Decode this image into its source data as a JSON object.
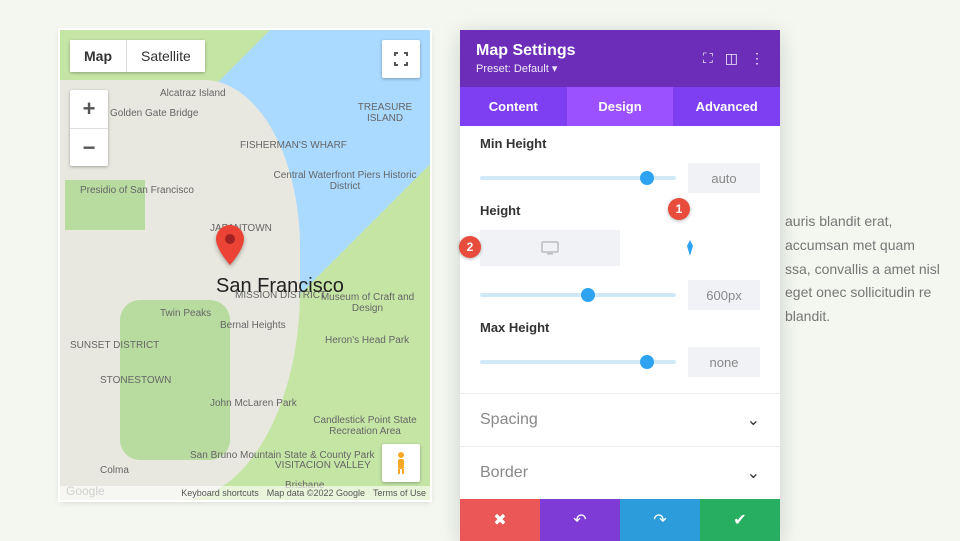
{
  "bg_text": "auris blandit erat, accumsan met quam ssa, convallis a amet nisl eget onec sollicitudin re blandit.",
  "map": {
    "tab_map": "Map",
    "tab_satellite": "Satellite",
    "zoom_in": "+",
    "zoom_out": "−",
    "city": "San Francisco",
    "places": {
      "alcatraz": "Alcatraz Island",
      "treasure": "TREASURE\nISLAND",
      "ggb": "Golden Gate Bridge",
      "fisherman": "FISHERMAN'S\nWHARF",
      "central": "Central\nWaterfront\nPiers Historic\nDistrict",
      "presidio": "Presidio of\nSan Francisco",
      "jt": "JAPANTOWN",
      "mission": "MISSION\nDISTRICT",
      "craft": "Museum of\nCraft and Design",
      "twin": "Twin Peaks",
      "bernal": "Bernal Heights",
      "herons": "Heron's\nHead Park",
      "sd": "SUNSET\nDISTRICT",
      "stonestown": "STONESTOWN",
      "mclaren": "John McLaren Park",
      "candlestick": "Candlestick\nPoint State\nRecreation\nArea",
      "sanbruno": "San Bruno\nMountain State\n& County Park",
      "colma": "Colma",
      "visitacion": "VISITACION\nVALLEY",
      "brisbane": "Brisbane"
    },
    "footer": {
      "google": "Google",
      "shortcuts": "Keyboard shortcuts",
      "data": "Map data ©2022 Google",
      "terms": "Terms of Use"
    }
  },
  "panel": {
    "title": "Map Settings",
    "preset": "Preset: Default ▾",
    "tabs": {
      "content": "Content",
      "design": "Design",
      "advanced": "Advanced"
    },
    "min_height": {
      "label": "Min Height",
      "value": "auto",
      "pos": 85
    },
    "height": {
      "label": "Height",
      "value": "600px",
      "pos": 55
    },
    "max_height": {
      "label": "Max Height",
      "value": "none",
      "pos": 85
    },
    "spacing": "Spacing",
    "border": "Border"
  },
  "annotations": {
    "a1": "1",
    "a2": "2"
  }
}
